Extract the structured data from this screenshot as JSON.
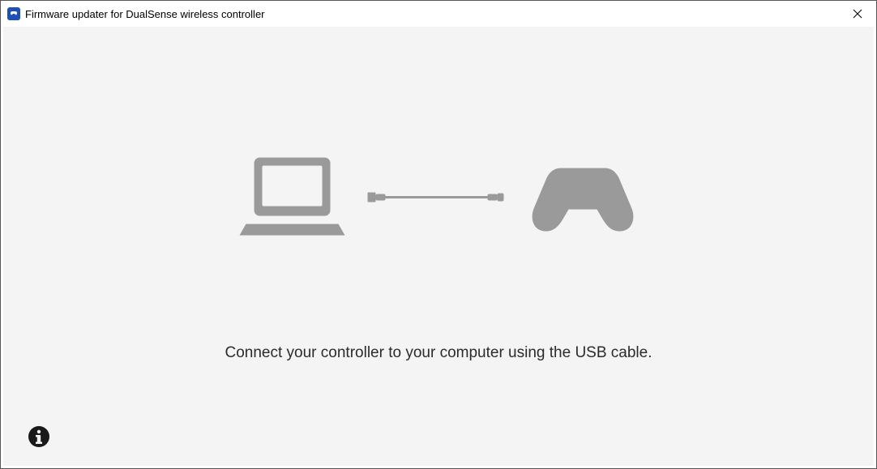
{
  "titlebar": {
    "title": "Firmware updater for DualSense wireless controller"
  },
  "main": {
    "instruction": "Connect your controller to your computer using the USB cable."
  },
  "icons": {
    "app": "controller-app-icon",
    "close": "close-icon",
    "laptop": "laptop-icon",
    "cable": "usb-cable-icon",
    "controller": "controller-icon",
    "info": "info-icon"
  },
  "colors": {
    "illustration": "#9a9a9a",
    "background": "#f4f4f5",
    "text": "#2b2b2b",
    "info_fill": "#1a1a1a"
  }
}
